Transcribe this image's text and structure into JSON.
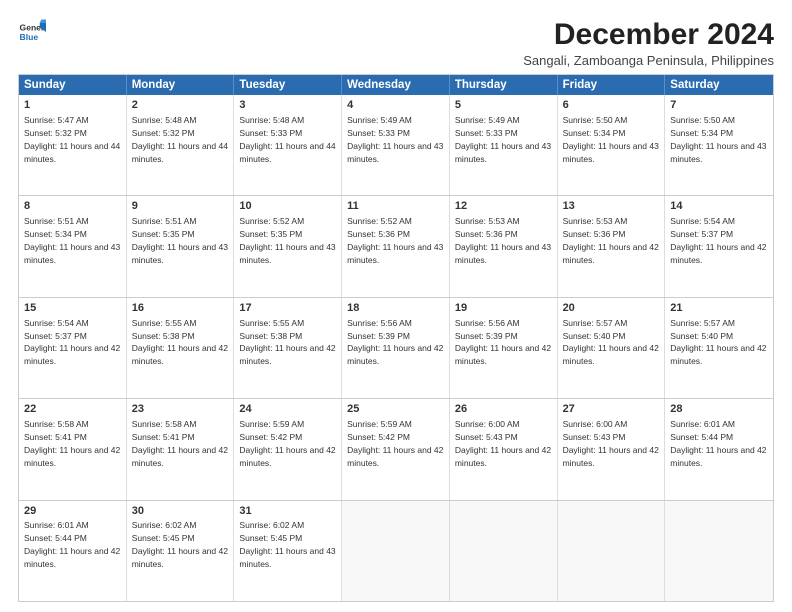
{
  "logo": {
    "line1": "General",
    "line2": "Blue"
  },
  "title": "December 2024",
  "subtitle": "Sangali, Zamboanga Peninsula, Philippines",
  "header_days": [
    "Sunday",
    "Monday",
    "Tuesday",
    "Wednesday",
    "Thursday",
    "Friday",
    "Saturday"
  ],
  "weeks": [
    [
      {
        "day": "1",
        "sunrise": "5:47 AM",
        "sunset": "5:32 PM",
        "daylight": "11 hours and 44 minutes."
      },
      {
        "day": "2",
        "sunrise": "5:48 AM",
        "sunset": "5:32 PM",
        "daylight": "11 hours and 44 minutes."
      },
      {
        "day": "3",
        "sunrise": "5:48 AM",
        "sunset": "5:33 PM",
        "daylight": "11 hours and 44 minutes."
      },
      {
        "day": "4",
        "sunrise": "5:49 AM",
        "sunset": "5:33 PM",
        "daylight": "11 hours and 43 minutes."
      },
      {
        "day": "5",
        "sunrise": "5:49 AM",
        "sunset": "5:33 PM",
        "daylight": "11 hours and 43 minutes."
      },
      {
        "day": "6",
        "sunrise": "5:50 AM",
        "sunset": "5:34 PM",
        "daylight": "11 hours and 43 minutes."
      },
      {
        "day": "7",
        "sunrise": "5:50 AM",
        "sunset": "5:34 PM",
        "daylight": "11 hours and 43 minutes."
      }
    ],
    [
      {
        "day": "8",
        "sunrise": "5:51 AM",
        "sunset": "5:34 PM",
        "daylight": "11 hours and 43 minutes."
      },
      {
        "day": "9",
        "sunrise": "5:51 AM",
        "sunset": "5:35 PM",
        "daylight": "11 hours and 43 minutes."
      },
      {
        "day": "10",
        "sunrise": "5:52 AM",
        "sunset": "5:35 PM",
        "daylight": "11 hours and 43 minutes."
      },
      {
        "day": "11",
        "sunrise": "5:52 AM",
        "sunset": "5:36 PM",
        "daylight": "11 hours and 43 minutes."
      },
      {
        "day": "12",
        "sunrise": "5:53 AM",
        "sunset": "5:36 PM",
        "daylight": "11 hours and 43 minutes."
      },
      {
        "day": "13",
        "sunrise": "5:53 AM",
        "sunset": "5:36 PM",
        "daylight": "11 hours and 42 minutes."
      },
      {
        "day": "14",
        "sunrise": "5:54 AM",
        "sunset": "5:37 PM",
        "daylight": "11 hours and 42 minutes."
      }
    ],
    [
      {
        "day": "15",
        "sunrise": "5:54 AM",
        "sunset": "5:37 PM",
        "daylight": "11 hours and 42 minutes."
      },
      {
        "day": "16",
        "sunrise": "5:55 AM",
        "sunset": "5:38 PM",
        "daylight": "11 hours and 42 minutes."
      },
      {
        "day": "17",
        "sunrise": "5:55 AM",
        "sunset": "5:38 PM",
        "daylight": "11 hours and 42 minutes."
      },
      {
        "day": "18",
        "sunrise": "5:56 AM",
        "sunset": "5:39 PM",
        "daylight": "11 hours and 42 minutes."
      },
      {
        "day": "19",
        "sunrise": "5:56 AM",
        "sunset": "5:39 PM",
        "daylight": "11 hours and 42 minutes."
      },
      {
        "day": "20",
        "sunrise": "5:57 AM",
        "sunset": "5:40 PM",
        "daylight": "11 hours and 42 minutes."
      },
      {
        "day": "21",
        "sunrise": "5:57 AM",
        "sunset": "5:40 PM",
        "daylight": "11 hours and 42 minutes."
      }
    ],
    [
      {
        "day": "22",
        "sunrise": "5:58 AM",
        "sunset": "5:41 PM",
        "daylight": "11 hours and 42 minutes."
      },
      {
        "day": "23",
        "sunrise": "5:58 AM",
        "sunset": "5:41 PM",
        "daylight": "11 hours and 42 minutes."
      },
      {
        "day": "24",
        "sunrise": "5:59 AM",
        "sunset": "5:42 PM",
        "daylight": "11 hours and 42 minutes."
      },
      {
        "day": "25",
        "sunrise": "5:59 AM",
        "sunset": "5:42 PM",
        "daylight": "11 hours and 42 minutes."
      },
      {
        "day": "26",
        "sunrise": "6:00 AM",
        "sunset": "5:43 PM",
        "daylight": "11 hours and 42 minutes."
      },
      {
        "day": "27",
        "sunrise": "6:00 AM",
        "sunset": "5:43 PM",
        "daylight": "11 hours and 42 minutes."
      },
      {
        "day": "28",
        "sunrise": "6:01 AM",
        "sunset": "5:44 PM",
        "daylight": "11 hours and 42 minutes."
      }
    ],
    [
      {
        "day": "29",
        "sunrise": "6:01 AM",
        "sunset": "5:44 PM",
        "daylight": "11 hours and 42 minutes."
      },
      {
        "day": "30",
        "sunrise": "6:02 AM",
        "sunset": "5:45 PM",
        "daylight": "11 hours and 42 minutes."
      },
      {
        "day": "31",
        "sunrise": "6:02 AM",
        "sunset": "5:45 PM",
        "daylight": "11 hours and 43 minutes."
      },
      null,
      null,
      null,
      null
    ]
  ]
}
